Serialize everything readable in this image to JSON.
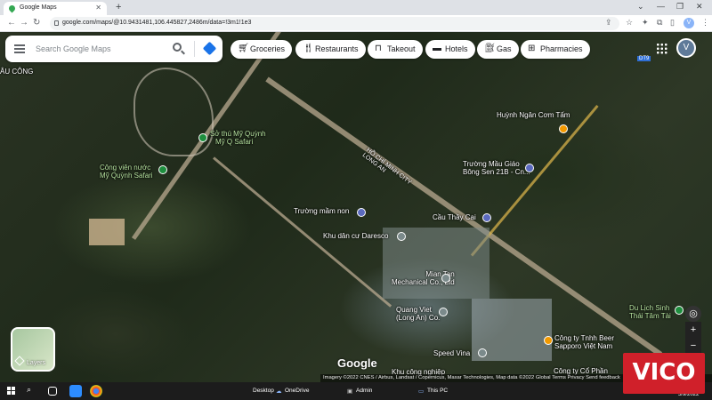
{
  "browser": {
    "tab_title": "Google Maps",
    "new_tab": "+",
    "url": "google.com/maps/@10.9431481,106.445827,2486m/data=!3m1!1e3",
    "profile_initial": "V"
  },
  "search": {
    "placeholder": "Search Google Maps"
  },
  "chips": [
    {
      "label": "Groceries",
      "icon": "cart-icon"
    },
    {
      "label": "Restaurants",
      "icon": "fork-knife-icon"
    },
    {
      "label": "Takeout",
      "icon": "bag-icon"
    },
    {
      "label": "Hotels",
      "icon": "bed-icon"
    },
    {
      "label": "Gas",
      "icon": "fuel-icon"
    },
    {
      "label": "Pharmacies",
      "icon": "pharmacy-icon"
    }
  ],
  "user": {
    "initial": "V"
  },
  "map": {
    "labels": {
      "area_top_left": "ÂU CÔNG",
      "safari_line1": "Sở thú Mỹ Quỳnh",
      "safari_line2": "Mỹ Q Safari",
      "park_line1": "Công viên nước",
      "park_line2": "Mỹ Quỳnh Safari",
      "highway_line1": "HỒ CHÍ MINH CITY",
      "highway_line2": "LONG AN",
      "restaurant": "Huỳnh Ngân Cơm Tấm",
      "school_line1": "Trường Mầu Giáo",
      "school_line2": "Bông Sen 21B - Cn...",
      "kindergarten": "Trường mầm non",
      "bridge": "Cầu Thầy Cai",
      "residential": "Khu dân cư Daresco",
      "company1_line1": "Mian Tan",
      "company1_line2": "Mechanical Co., Ltd",
      "company2_line1": "Quang Viet",
      "company2_line2": "(Long An) Co.",
      "speed": "Speed Vina",
      "sapporo_line1": "Công ty Tnhh Beer",
      "sapporo_line2": "Sapporo Việt Nam",
      "eco_line1": "Du Lịch Sinh",
      "eco_line2": "Thái Tâm Tài",
      "industrial": "Khu công nghiệp",
      "company3": "Công ty Cổ Phần",
      "road_label": "DT9"
    },
    "layers_label": "Layers",
    "zoom_in": "+",
    "zoom_out": "−",
    "logo": "Google",
    "attribution": "Imagery ©2022 CNES / Airbus, Landsat / Copernicus, Maxar Technologies, Map data ©2022    Global    Terms    Privacy    Send feedback"
  },
  "taskbar": {
    "desktop": "Desktop",
    "onedrive": "OneDrive",
    "admin": "Admin",
    "thispc": "This PC",
    "date": "5/9/2022"
  },
  "watermark": "VICO"
}
